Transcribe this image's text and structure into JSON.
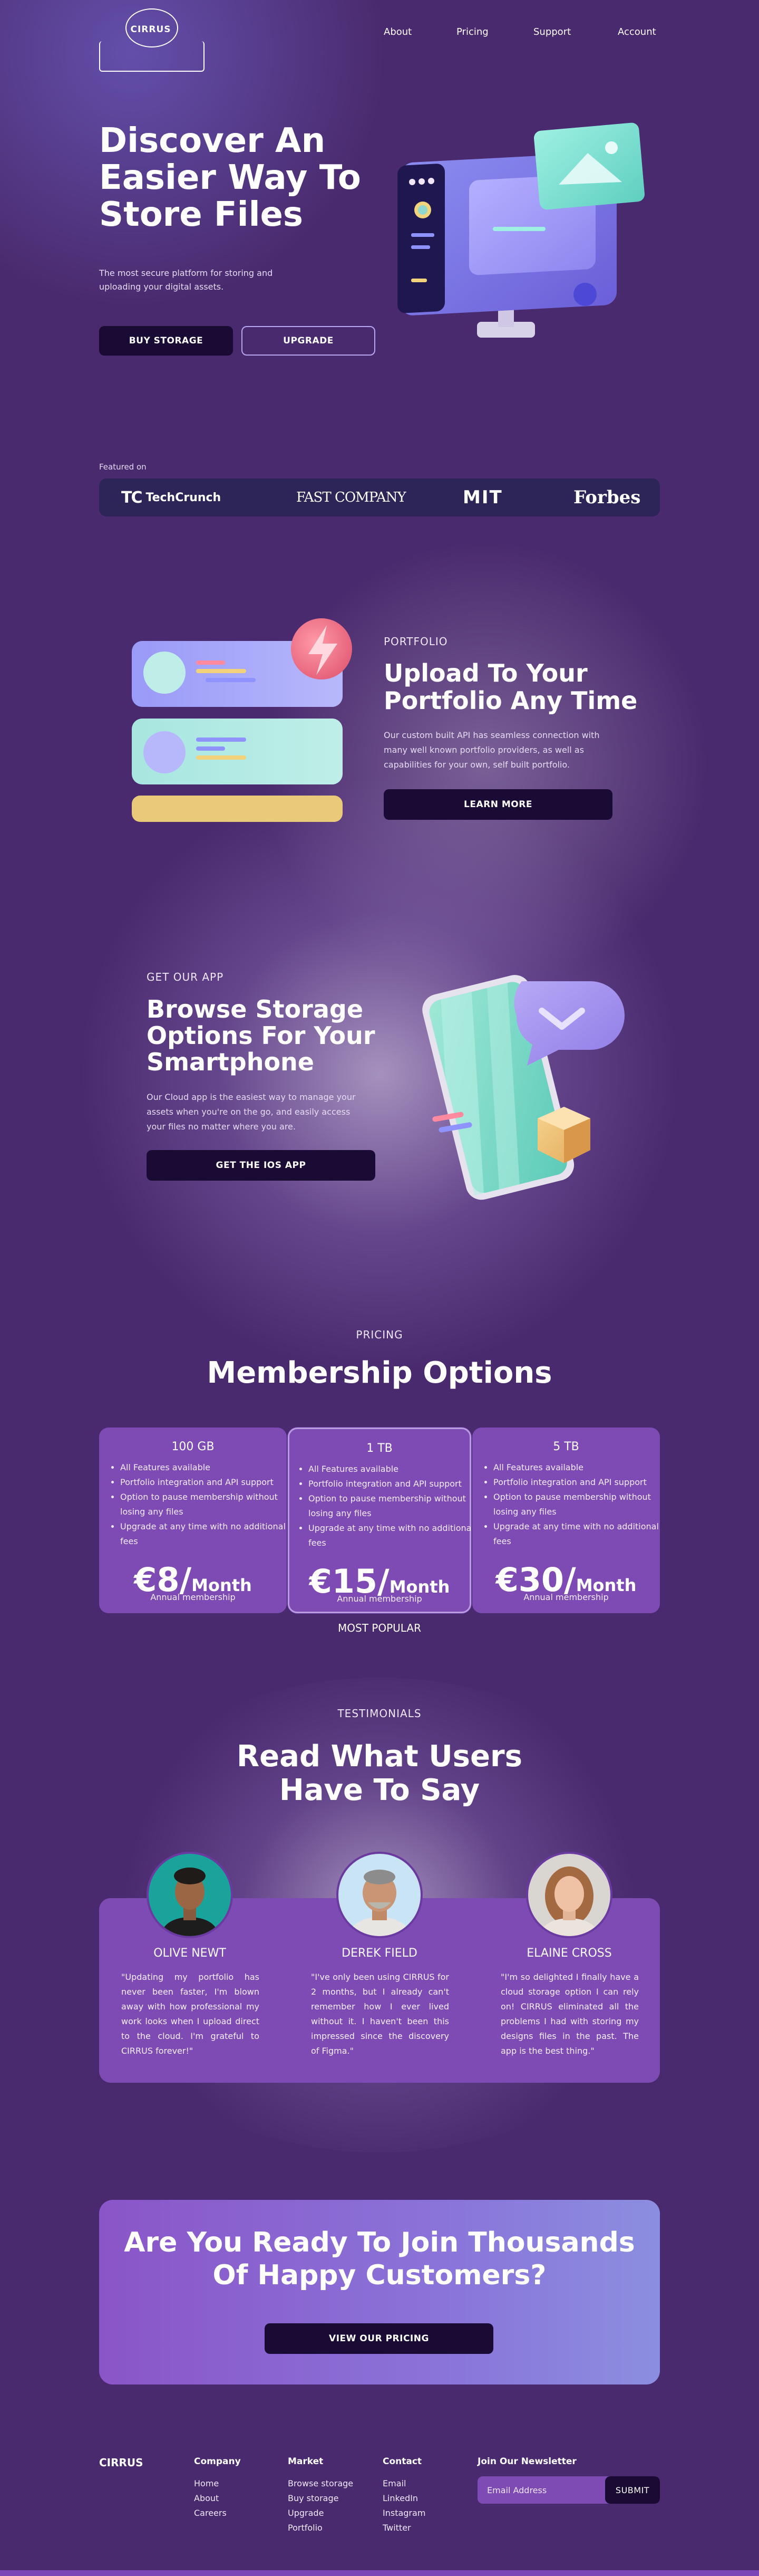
{
  "brand": {
    "logo_text": "CIRRUS"
  },
  "nav": {
    "items": [
      "About",
      "Pricing",
      "Support",
      "Account"
    ]
  },
  "hero": {
    "title_lines": [
      "Discover An",
      "Easier Way To",
      "Store Files"
    ],
    "subtitle": "The most secure platform for storing and uploading your digital assets.",
    "primary_button": "BUY STORAGE",
    "secondary_button": "UPGRADE"
  },
  "featured": {
    "label": "Featured on",
    "logos": [
      "TechCrunch",
      "FAST COMPANY",
      "MIT",
      "Forbes"
    ]
  },
  "portfolio": {
    "kicker": "PORTFOLIO",
    "title_lines": [
      "Upload To Your",
      "Portfolio Any Time"
    ],
    "body": "Our custom built API has seamless connection with many well known portfolio providers, as well as capabilities for your own, self built portfolio.",
    "button": "LEARN MORE"
  },
  "app": {
    "kicker": "GET OUR APP",
    "title_lines": [
      "Browse Storage",
      "Options For Your",
      "Smartphone"
    ],
    "body": "Our Cloud app is the easiest way to manage your assets when you're on the go, and easily access your files no matter where you are.",
    "button": "GET THE IOS APP"
  },
  "pricing": {
    "kicker": "PRICING",
    "title": "Membership Options",
    "popular_label": "MOST POPULAR",
    "plans": [
      {
        "size": "100 GB",
        "price": "€8/",
        "unit": "Month",
        "period": "Annual membership",
        "features": [
          "All Features available",
          "Portfolio integration and API support",
          "Option to pause membership without losing any files",
          "Upgrade at any time with no additional fees"
        ]
      },
      {
        "size": "1 TB",
        "price": "€15/",
        "unit": "Month",
        "period": "Annual membership",
        "features": [
          "All Features available",
          "Portfolio integration and API support",
          "Option to pause membership without losing any files",
          "Upgrade at any time with no additional fees"
        ]
      },
      {
        "size": "5 TB",
        "price": "€30/",
        "unit": "Month",
        "period": "Annual membership",
        "features": [
          "All Features available",
          "Portfolio integration and API support",
          "Option to pause membership without losing any files",
          "Upgrade at any time with no additional fees"
        ]
      }
    ]
  },
  "testimonials": {
    "kicker": "TESTIMONIALS",
    "title_lines": [
      "Read What Users",
      "Have To Say"
    ],
    "items": [
      {
        "name": "OLIVE NEWT",
        "quote": "\"Updating my portfolio has never been faster, I'm blown away with how professional my work looks when I upload direct to the cloud. I'm grateful to CIRRUS forever!\""
      },
      {
        "name": "DEREK FIELD",
        "quote": "\"I've only been using CIRRUS for 2 months, but I already can't remember how I ever lived without it. I haven't been this impressed since the discovery of Figma.\""
      },
      {
        "name": "ELAINE CROSS",
        "quote": "\"I'm so delighted I finally have a cloud storage option I can rely on! CIRRUS eliminated all the problems I had with storing my designs files in the past. The app is the best thing.\""
      }
    ]
  },
  "cta": {
    "title_lines": [
      "Are You Ready To Join Thousands",
      "Of Happy Customers?"
    ],
    "button": "VIEW OUR PRICING"
  },
  "footer": {
    "brand": "CIRRUS",
    "columns": [
      {
        "heading": "Company",
        "links": [
          "Home",
          "About",
          "Careers"
        ]
      },
      {
        "heading": "Market",
        "links": [
          "Browse storage",
          "Buy storage",
          "Upgrade",
          "Portfolio"
        ]
      },
      {
        "heading": "Contact",
        "links": [
          "Email",
          "LinkedIn",
          "Instagram",
          "Twitter"
        ]
      }
    ],
    "newsletter": {
      "heading": "Join Our Newsletter",
      "placeholder": "Email Address",
      "button": "SUBMIT"
    }
  },
  "colors": {
    "page_bg": "#4a2a6e",
    "card": "#7e4bb4",
    "dark_button": "#1a0b35",
    "featured_bar": "#2d2558"
  }
}
